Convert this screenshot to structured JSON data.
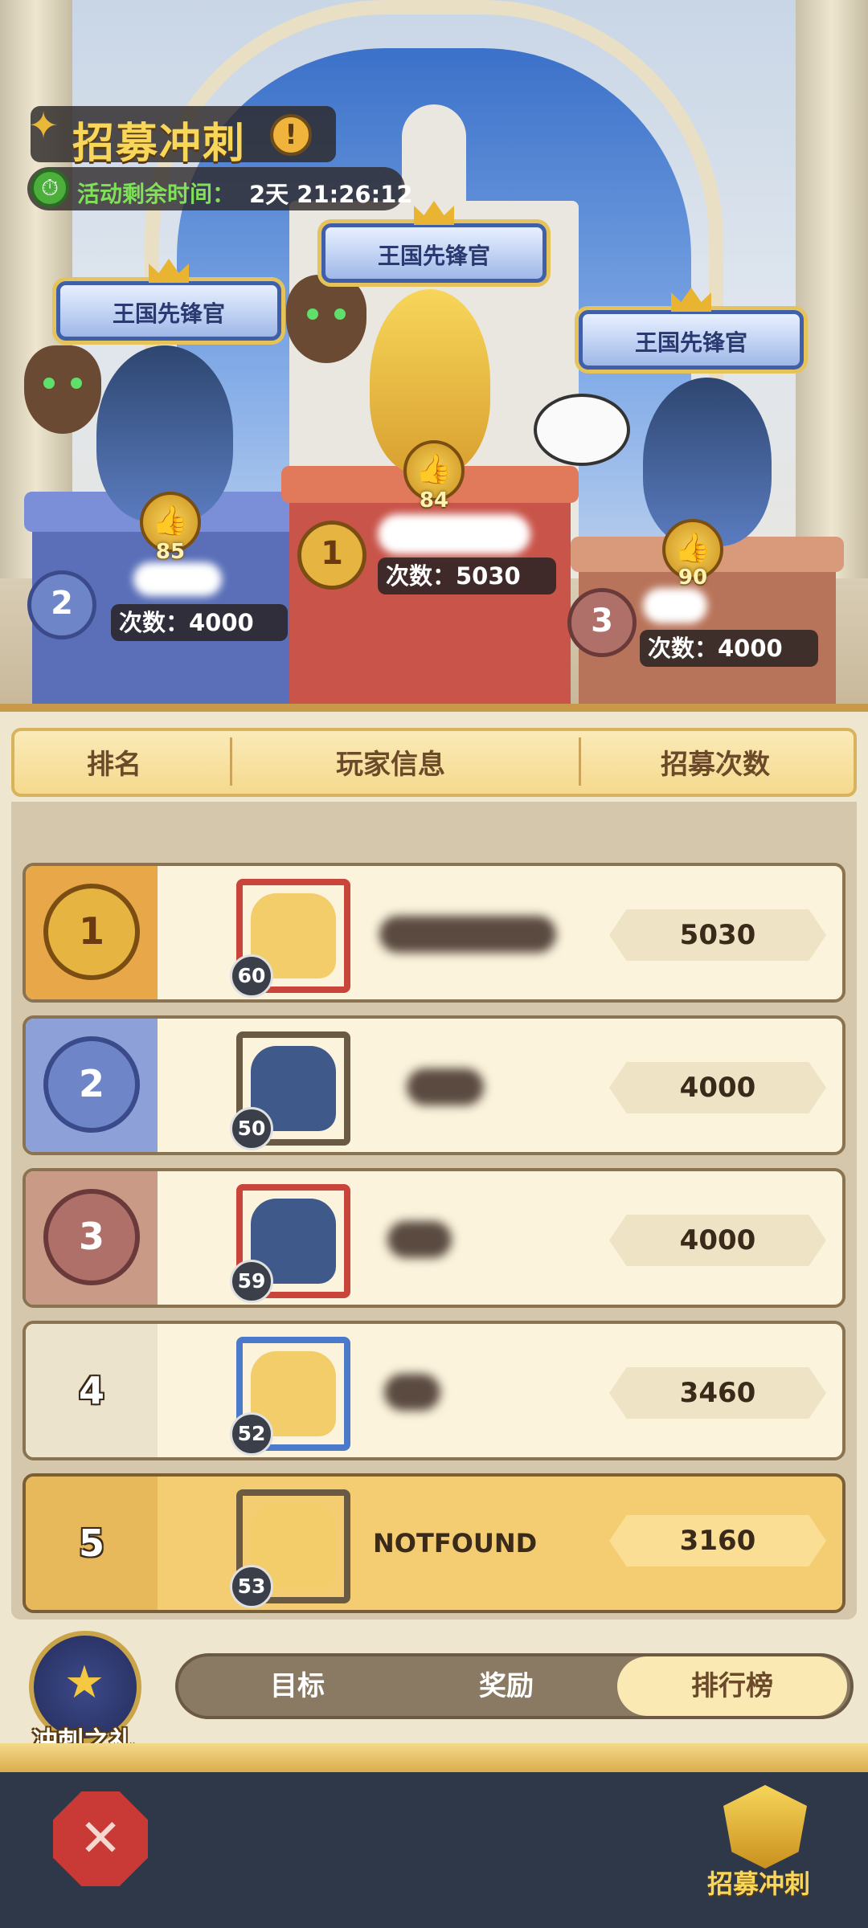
{
  "event": {
    "title": "招募冲刺",
    "info_glyph": "!",
    "timer_label": "活动剩余时间：",
    "timer_value": "2天 21:26:12"
  },
  "podium": [
    {
      "place": "1",
      "title": "王国先锋官",
      "likes": "84",
      "count_text": "次数：5030",
      "color": "#c9544a"
    },
    {
      "place": "2",
      "title": "王国先锋官",
      "likes": "85",
      "count_text": "次数：4000",
      "color": "#5a6fb8"
    },
    {
      "place": "3",
      "title": "王国先锋官",
      "likes": "90",
      "count_text": "次数：4000",
      "color": "#b8745a"
    }
  ],
  "leaderboard": {
    "headers": {
      "rank": "排名",
      "player": "玩家信息",
      "count": "招募次数"
    },
    "rows": [
      {
        "rank": "1",
        "level": "60",
        "name": "",
        "count": "5030",
        "rank_bg": "#e8a84a",
        "medal_color": "#e6b440",
        "avatar_color": "#f3cd6a",
        "frame_color": "#c9443a"
      },
      {
        "rank": "2",
        "level": "50",
        "name": "",
        "count": "4000",
        "rank_bg": "#8ea0d8",
        "medal_color": "#6e86c8",
        "avatar_color": "#3f5a8a",
        "frame_color": "#6a5a44"
      },
      {
        "rank": "3",
        "level": "59",
        "name": "",
        "count": "4000",
        "rank_bg": "#c99a86",
        "medal_color": "#b0706a",
        "avatar_color": "#3f5a8a",
        "frame_color": "#c9443a"
      },
      {
        "rank": "4",
        "level": "52",
        "name": "",
        "count": "3460",
        "rank_bg": "#ece3cc",
        "medal_color": "",
        "avatar_color": "#f3cd6a",
        "frame_color": "#4a7ac9"
      },
      {
        "rank": "5",
        "level": "53",
        "name": "NOTFOUND",
        "count": "3160",
        "rank_bg": "#e8b95a",
        "medal_color": "",
        "avatar_color": "#f3cd6a",
        "frame_color": "#6a5a44"
      }
    ]
  },
  "gift": {
    "label": "冲刺之礼",
    "icon": "trophy-icon"
  },
  "tabs": [
    {
      "label": "目标",
      "active": false
    },
    {
      "label": "奖励",
      "active": false
    },
    {
      "label": "排行榜",
      "active": true
    }
  ],
  "bottom": {
    "close_icon": "crossed-swords-icon",
    "recruit_label": "招募冲刺"
  }
}
